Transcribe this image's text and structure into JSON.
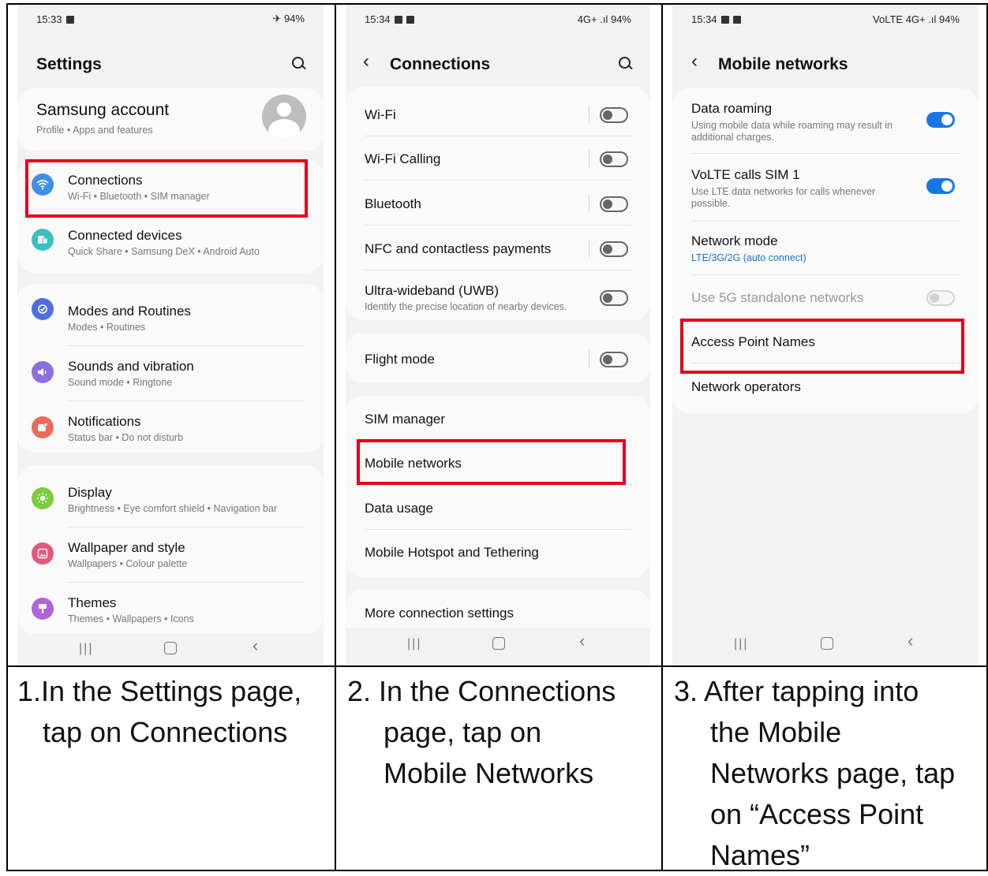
{
  "panel1": {
    "status": {
      "time": "15:33",
      "right": "✈ 94%"
    },
    "title": "Settings",
    "account": {
      "name": "Samsung account",
      "sub": "Profile  •  Apps and features"
    },
    "items": [
      {
        "label": "Connections",
        "sub": "Wi-Fi  •  Bluetooth  •  SIM manager"
      },
      {
        "label": "Connected devices",
        "sub": "Quick Share  •  Samsung DeX  •  Android Auto"
      },
      {
        "label": "Modes and Routines",
        "sub": "Modes  •  Routines"
      },
      {
        "label": "Sounds and vibration",
        "sub": "Sound mode  •  Ringtone"
      },
      {
        "label": "Notifications",
        "sub": "Status bar  •  Do not disturb"
      },
      {
        "label": "Display",
        "sub": "Brightness  •  Eye comfort shield  •  Navigation bar"
      },
      {
        "label": "Wallpaper and style",
        "sub": "Wallpapers  •  Colour palette"
      },
      {
        "label": "Themes",
        "sub": "Themes  •  Wallpapers  •  Icons"
      }
    ]
  },
  "panel2": {
    "status": {
      "time": "15:34",
      "right": "4G+ .ıl 94%"
    },
    "title": "Connections",
    "items": [
      {
        "label": "Wi-Fi"
      },
      {
        "label": "Wi-Fi Calling"
      },
      {
        "label": "Bluetooth"
      },
      {
        "label": "NFC and contactless payments"
      },
      {
        "label": "Ultra-wideband (UWB)",
        "sub": "Identify the precise location of nearby devices."
      },
      {
        "label": "Flight mode"
      },
      {
        "label": "SIM manager"
      },
      {
        "label": "Mobile networks"
      },
      {
        "label": "Data usage"
      },
      {
        "label": "Mobile Hotspot and Tethering"
      },
      {
        "label": "More connection settings"
      }
    ]
  },
  "panel3": {
    "status": {
      "time": "15:34",
      "right": "VoLTE 4G+ .ıl 94%"
    },
    "title": "Mobile networks",
    "items": [
      {
        "label": "Data roaming",
        "sub": "Using mobile data while roaming may result in additional charges."
      },
      {
        "label": "VoLTE calls SIM 1",
        "sub": "Use LTE data networks for calls whenever possible."
      },
      {
        "label": "Network mode",
        "sub": "LTE/3G/2G (auto connect)"
      },
      {
        "label": "Use 5G standalone networks"
      },
      {
        "label": "Access Point Names"
      },
      {
        "label": "Network operators"
      }
    ]
  },
  "captions": {
    "c1_line1": "1.In the Settings page,",
    "c1_line2": "tap on Connections",
    "c2_line1": "2. In the Connections",
    "c2_line2": "page, tap on",
    "c2_line3": "Mobile Networks",
    "c3_line1": "3. After tapping into",
    "c3_line2": "the Mobile",
    "c3_line3": "Networks page, tap",
    "c3_line4": "on “Access Point",
    "c3_line5": "Names”"
  },
  "colors": {
    "highlight": "#e3001b",
    "toggle_on": "#1876e6",
    "link": "#1a73c8"
  },
  "icons": {
    "connections": "wifi-icon",
    "connected_devices": "devices-icon",
    "modes": "routines-icon",
    "sounds": "speaker-icon",
    "notifications": "bell-icon",
    "display": "sun-icon",
    "wallpaper": "image-icon",
    "themes": "brush-icon"
  }
}
